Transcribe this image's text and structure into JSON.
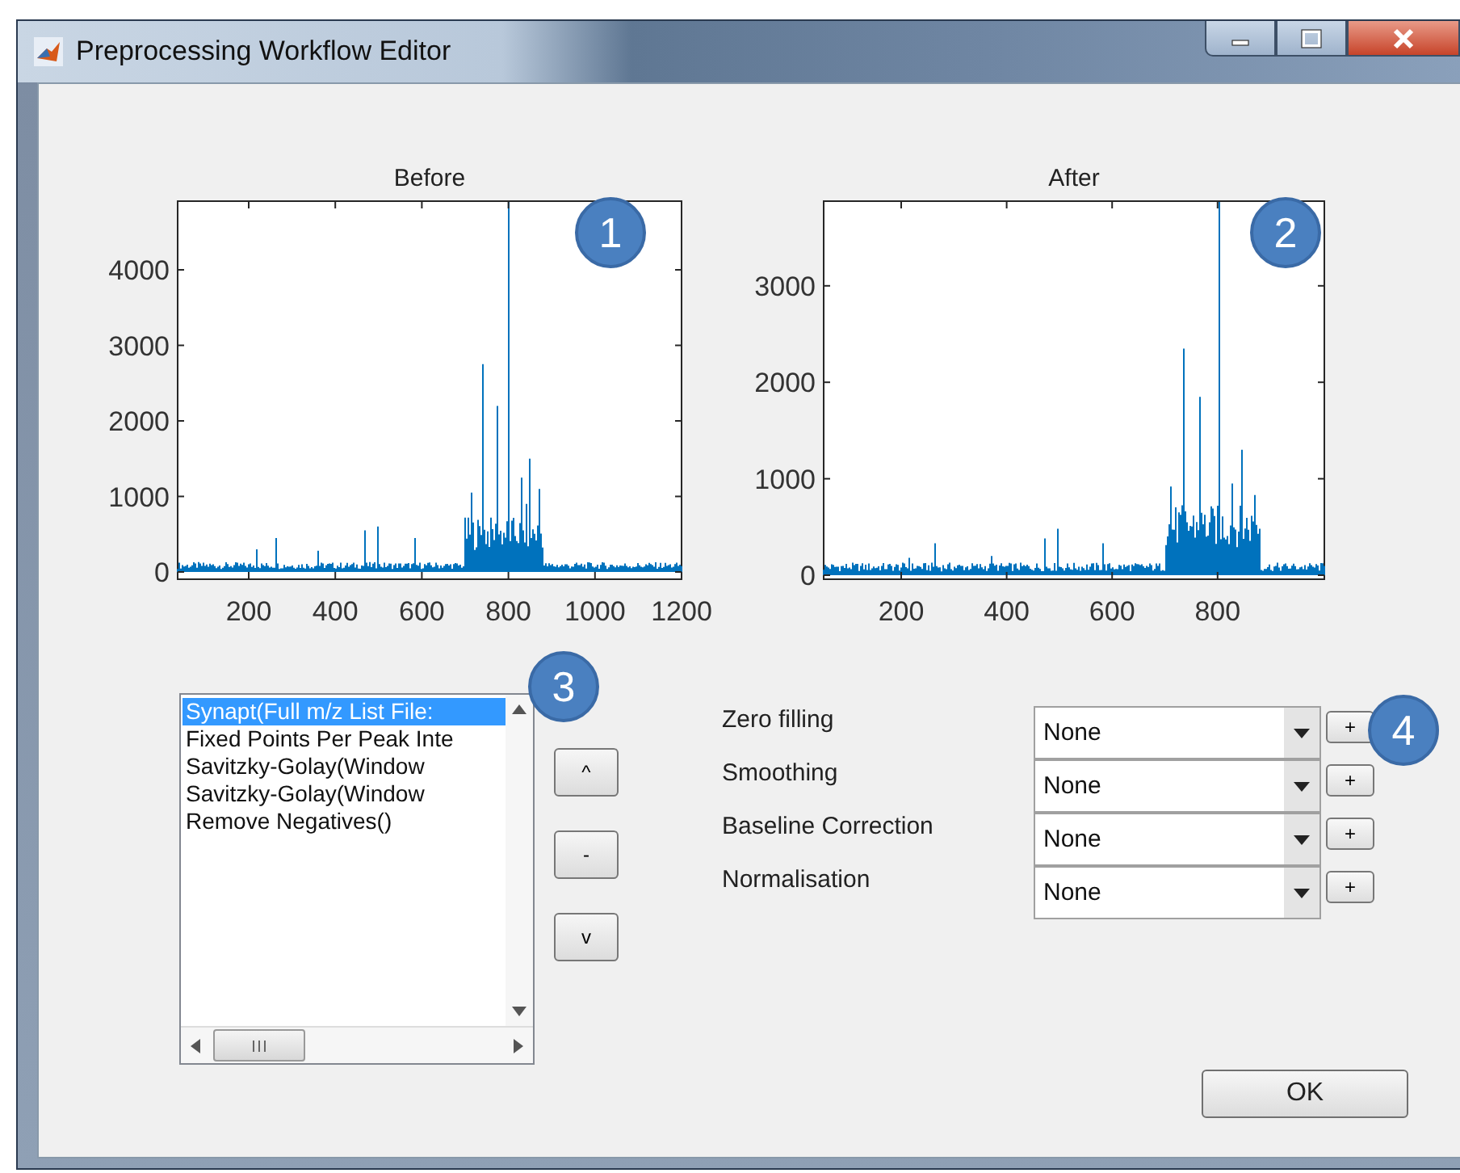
{
  "window": {
    "title": "Preprocessing Workflow Editor"
  },
  "plots": [
    {
      "title": "Before",
      "y_ticks": [
        "4000",
        "3000",
        "2000",
        "1000",
        "0"
      ],
      "x_ticks": [
        "200",
        "400",
        "600",
        "800",
        "1000",
        "1200"
      ]
    },
    {
      "title": "After",
      "y_ticks": [
        "3000",
        "2000",
        "1000",
        "0"
      ],
      "x_ticks": [
        "200",
        "400",
        "600",
        "800"
      ]
    }
  ],
  "workflow_list": {
    "items": [
      {
        "label": "Synapt(Full m/z List File:",
        "selected": true
      },
      {
        "label": "Fixed Points Per Peak Inte",
        "selected": false
      },
      {
        "label": "Savitzky-Golay(Window",
        "selected": false
      },
      {
        "label": "Savitzky-Golay(Window",
        "selected": false
      },
      {
        "label": "Remove Negatives()",
        "selected": false
      }
    ]
  },
  "move_buttons": [
    "^",
    "-",
    "v"
  ],
  "steps": [
    {
      "label": "Zero filling",
      "value": "None",
      "add": "+"
    },
    {
      "label": "Smoothing",
      "value": "None",
      "add": "+"
    },
    {
      "label": "Baseline Correction",
      "value": "None",
      "add": "+"
    },
    {
      "label": "Normalisation",
      "value": "None",
      "add": "+"
    }
  ],
  "ok_button": "OK",
  "callouts": [
    "1",
    "2",
    "3",
    "4"
  ]
}
